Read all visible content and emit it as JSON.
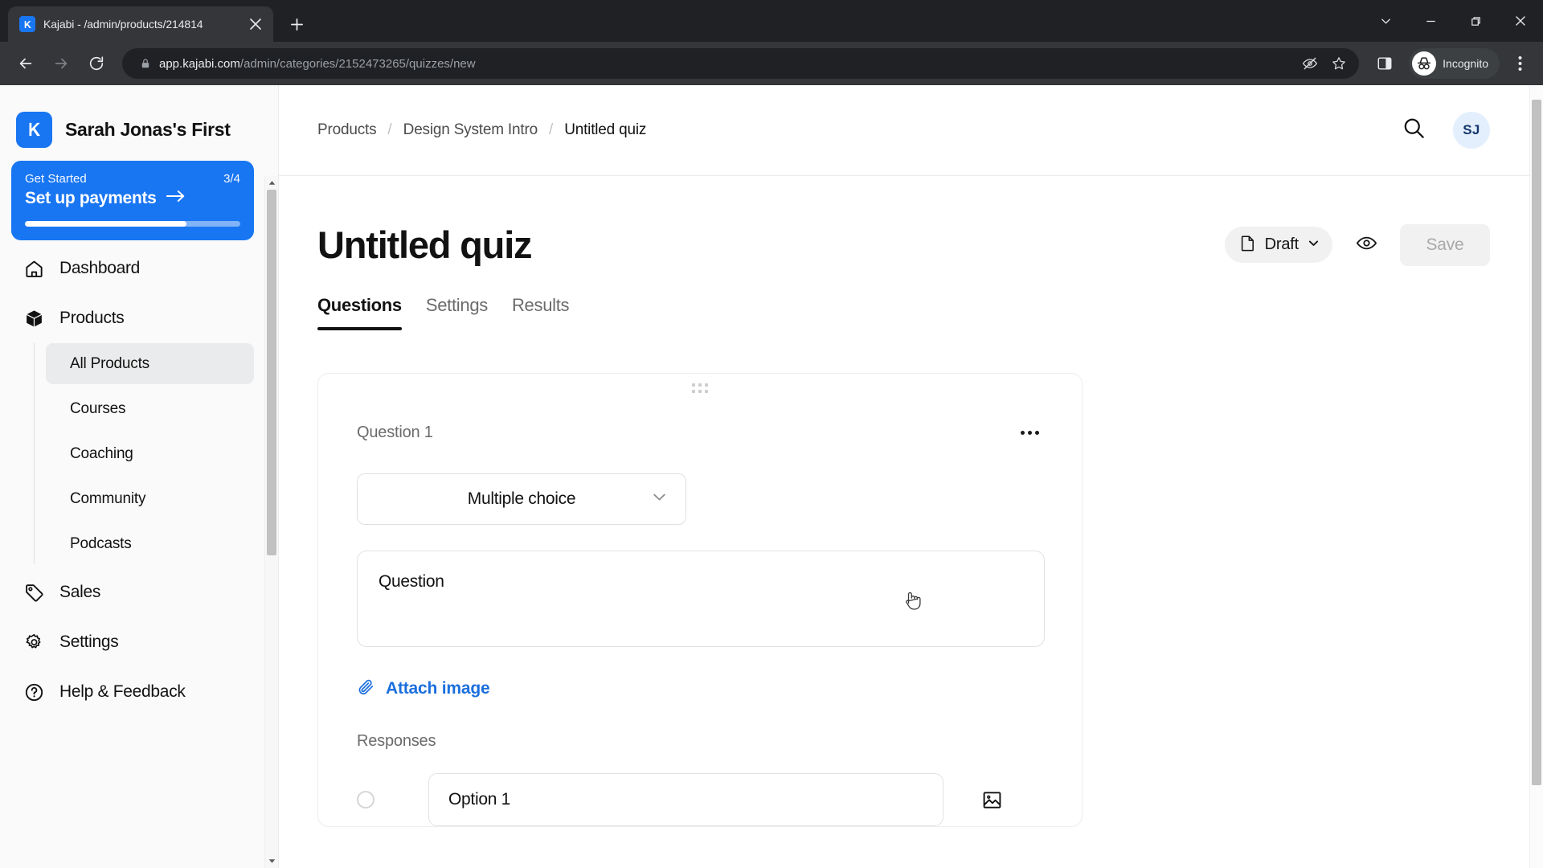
{
  "browser": {
    "tab": {
      "title": "Kajabi - /admin/products/214814",
      "favicon_icon": "kajabi-logo-icon",
      "close_icon": "close-icon"
    },
    "new_tab_icon": "plus-icon",
    "window_controls": {
      "chevron": "chevron-down-icon",
      "minimize": "minimize-icon",
      "maximize": "maximize-icon",
      "close": "close-icon"
    },
    "nav": {
      "back_icon": "back-arrow-icon",
      "forward_icon": "forward-arrow-icon",
      "reload_icon": "reload-icon"
    },
    "omnibox": {
      "lock_icon": "lock-icon",
      "url_domain": "app.kajabi.com",
      "url_path": "/admin/categories/2152473265/quizzes/new"
    },
    "omni_actions": {
      "tracking_icon": "eye-off-icon",
      "bookmark_icon": "star-icon",
      "side_panel_icon": "side-panel-icon",
      "incognito_icon": "incognito-icon",
      "incognito_label": "Incognito",
      "menu_icon": "kebab-menu-icon"
    }
  },
  "sidebar": {
    "brand_name": "Sarah Jonas's First",
    "brand_logo_icon": "kajabi-logo-icon",
    "get_started": {
      "label": "Get Started",
      "count": "3/4",
      "title": "Set up payments",
      "arrow_icon": "arrow-right-icon",
      "progress_percent": 75
    },
    "items": [
      {
        "label": "Dashboard",
        "icon": "home-icon"
      },
      {
        "label": "Products",
        "icon": "box-icon"
      },
      {
        "label": "Sales",
        "icon": "tag-icon"
      },
      {
        "label": "Settings",
        "icon": "gear-icon"
      },
      {
        "label": "Help & Feedback",
        "icon": "question-circle-icon"
      }
    ],
    "sub_items": [
      {
        "label": "All Products",
        "active": true
      },
      {
        "label": "Courses",
        "active": false
      },
      {
        "label": "Coaching",
        "active": false
      },
      {
        "label": "Community",
        "active": false
      },
      {
        "label": "Podcasts",
        "active": false
      }
    ]
  },
  "topbar": {
    "breadcrumb": [
      "Products",
      "Design System Intro",
      "Untitled quiz"
    ],
    "breadcrumb_separator": "/",
    "search_icon": "search-icon",
    "avatar_initials": "SJ"
  },
  "page": {
    "title": "Untitled quiz",
    "status": {
      "label": "Draft",
      "doc_icon": "document-icon",
      "chevron_icon": "chevron-down-icon"
    },
    "preview_icon": "eye-icon",
    "save_label": "Save",
    "tabs": [
      {
        "label": "Questions",
        "active": true
      },
      {
        "label": "Settings",
        "active": false
      },
      {
        "label": "Results",
        "active": false
      }
    ]
  },
  "question_card": {
    "drag_handle_icon": "drag-dots-icon",
    "label": "Question 1",
    "more_icon": "more-horizontal-icon",
    "type_value": "Multiple choice",
    "type_chevron_icon": "chevron-down-icon",
    "question_placeholder": "Question",
    "attach": {
      "icon": "paperclip-icon",
      "label": "Attach image"
    },
    "responses_label": "Responses",
    "responses": [
      {
        "radio_icon": "radio-unchecked-icon",
        "value": "Option 1",
        "image_icon": "image-icon"
      }
    ]
  },
  "colors": {
    "brand_blue": "#1976f2",
    "link_blue": "#1b6fdd",
    "text_dark": "#121212",
    "text_muted": "#6b6b6b",
    "chrome_dark": "#202124"
  }
}
